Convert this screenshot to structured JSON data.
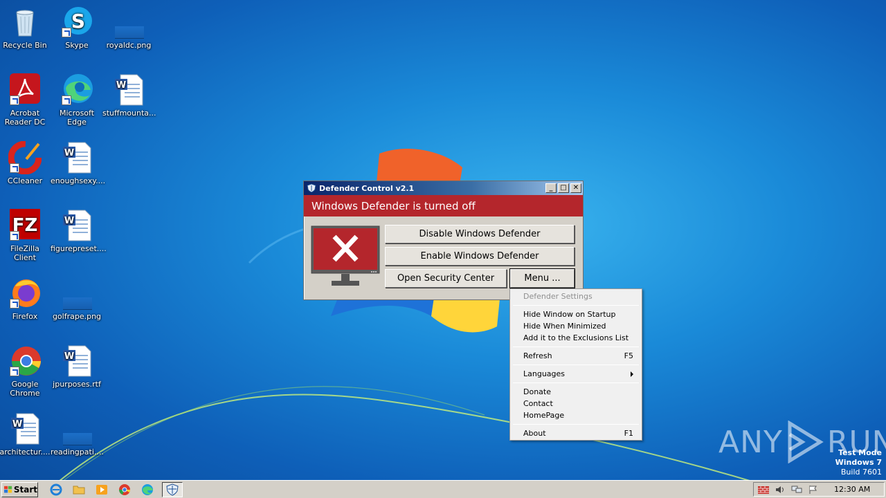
{
  "desktop": {
    "icons": [
      {
        "label": "Recycle Bin",
        "icon": "recycle-bin-icon"
      },
      {
        "label": "Skype",
        "icon": "skype-icon"
      },
      {
        "label": "royaldc.png",
        "icon": "image-file-icon"
      },
      {
        "label": "Acrobat Reader DC",
        "icon": "acrobat-icon"
      },
      {
        "label": "Microsoft Edge",
        "icon": "edge-icon"
      },
      {
        "label": "stuffmounta...",
        "icon": "word-doc-icon"
      },
      {
        "label": "CCleaner",
        "icon": "ccleaner-icon"
      },
      {
        "label": "enoughsexy....",
        "icon": "word-doc-icon"
      },
      {
        "label": "FileZilla Client",
        "icon": "filezilla-icon"
      },
      {
        "label": "figurepreset....",
        "icon": "word-doc-icon"
      },
      {
        "label": "Firefox",
        "icon": "firefox-icon"
      },
      {
        "label": "golfrape.png",
        "icon": "image-file-icon"
      },
      {
        "label": "Google Chrome",
        "icon": "chrome-icon"
      },
      {
        "label": "jpurposes.rtf",
        "icon": "word-doc-icon"
      },
      {
        "label": "architectur....",
        "icon": "word-doc-icon"
      },
      {
        "label": "readingpati....",
        "icon": "image-file-icon"
      }
    ]
  },
  "window": {
    "title": "Defender Control v2.1",
    "minimize": "_",
    "maximize": "□",
    "close": "✕",
    "banner": "Windows Defender is turned off",
    "banner_color": "#b4262c",
    "disable_label": "Disable Windows Defender",
    "enable_label": "Enable Windows Defender",
    "security_label": "Open Security Center",
    "menu_label": "Menu ..."
  },
  "context_menu": {
    "header": "Defender Settings",
    "hide_startup": "Hide Window on Startup",
    "hide_minimized": "Hide When Minimized",
    "add_exclusion": "Add it to the Exclusions List",
    "refresh": "Refresh",
    "refresh_key": "F5",
    "languages": "Languages",
    "donate": "Donate",
    "contact": "Contact",
    "homepage": "HomePage",
    "about": "About",
    "about_key": "F1"
  },
  "taskbar": {
    "start_label": "Start",
    "clock": "12:30 AM"
  },
  "watermark": {
    "line1": "Test Mode",
    "line2": "Windows 7",
    "line3": "Build 7601",
    "brand_left": "ANY",
    "brand_right": "RUN"
  }
}
